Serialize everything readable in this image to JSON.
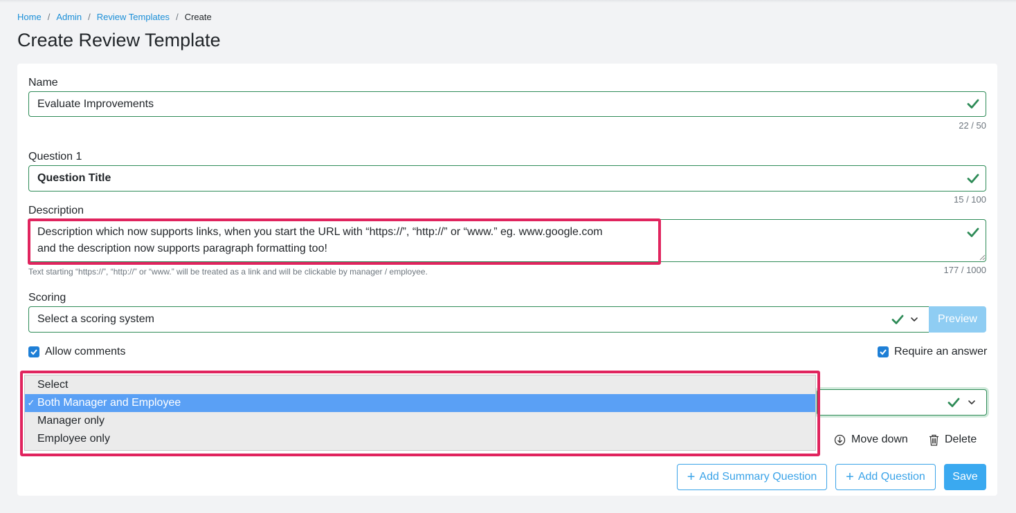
{
  "breadcrumb": {
    "home": "Home",
    "admin": "Admin",
    "review_templates": "Review Templates",
    "current": "Create",
    "separator": "/"
  },
  "page_title": "Create Review Template",
  "name": {
    "label": "Name",
    "value": "Evaluate Improvements",
    "counter": "22 / 50"
  },
  "question": {
    "label": "Question 1",
    "title_value": "Question Title",
    "title_counter": "15 / 100",
    "description_label": "Description",
    "description_value": "Description which now supports links, when you start the URL with “https://”, “http://” or “www.”  eg. www.google.com\nand the description now supports paragraph formatting too!",
    "description_help": "Text starting “https://”, “http://” or “www.” will be treated as a link and will be clickable by manager / employee.",
    "description_counter": "177 / 1000",
    "scoring_label": "Scoring",
    "scoring_value": "Select a scoring system",
    "preview_label": "Preview",
    "allow_comments_label": "Allow comments",
    "allow_comments_checked": true,
    "require_answer_label": "Require an answer",
    "require_answer_checked": true
  },
  "visibility_dropdown": {
    "options": [
      "Select",
      "Both Manager and Employee",
      "Manager only",
      "Employee only"
    ],
    "selected": "Both Manager and Employee",
    "selected_mark": "✓"
  },
  "actions": {
    "move_down": "Move down",
    "delete": "Delete"
  },
  "footer": {
    "add_summary": "Add Summary Question",
    "add_question": "Add Question",
    "save": "Save",
    "plus": "+"
  },
  "colors": {
    "valid_green": "#2e8b57",
    "link_blue": "#1b8fd8",
    "highlight": "#e0245e",
    "primary": "#3aa9f0"
  }
}
